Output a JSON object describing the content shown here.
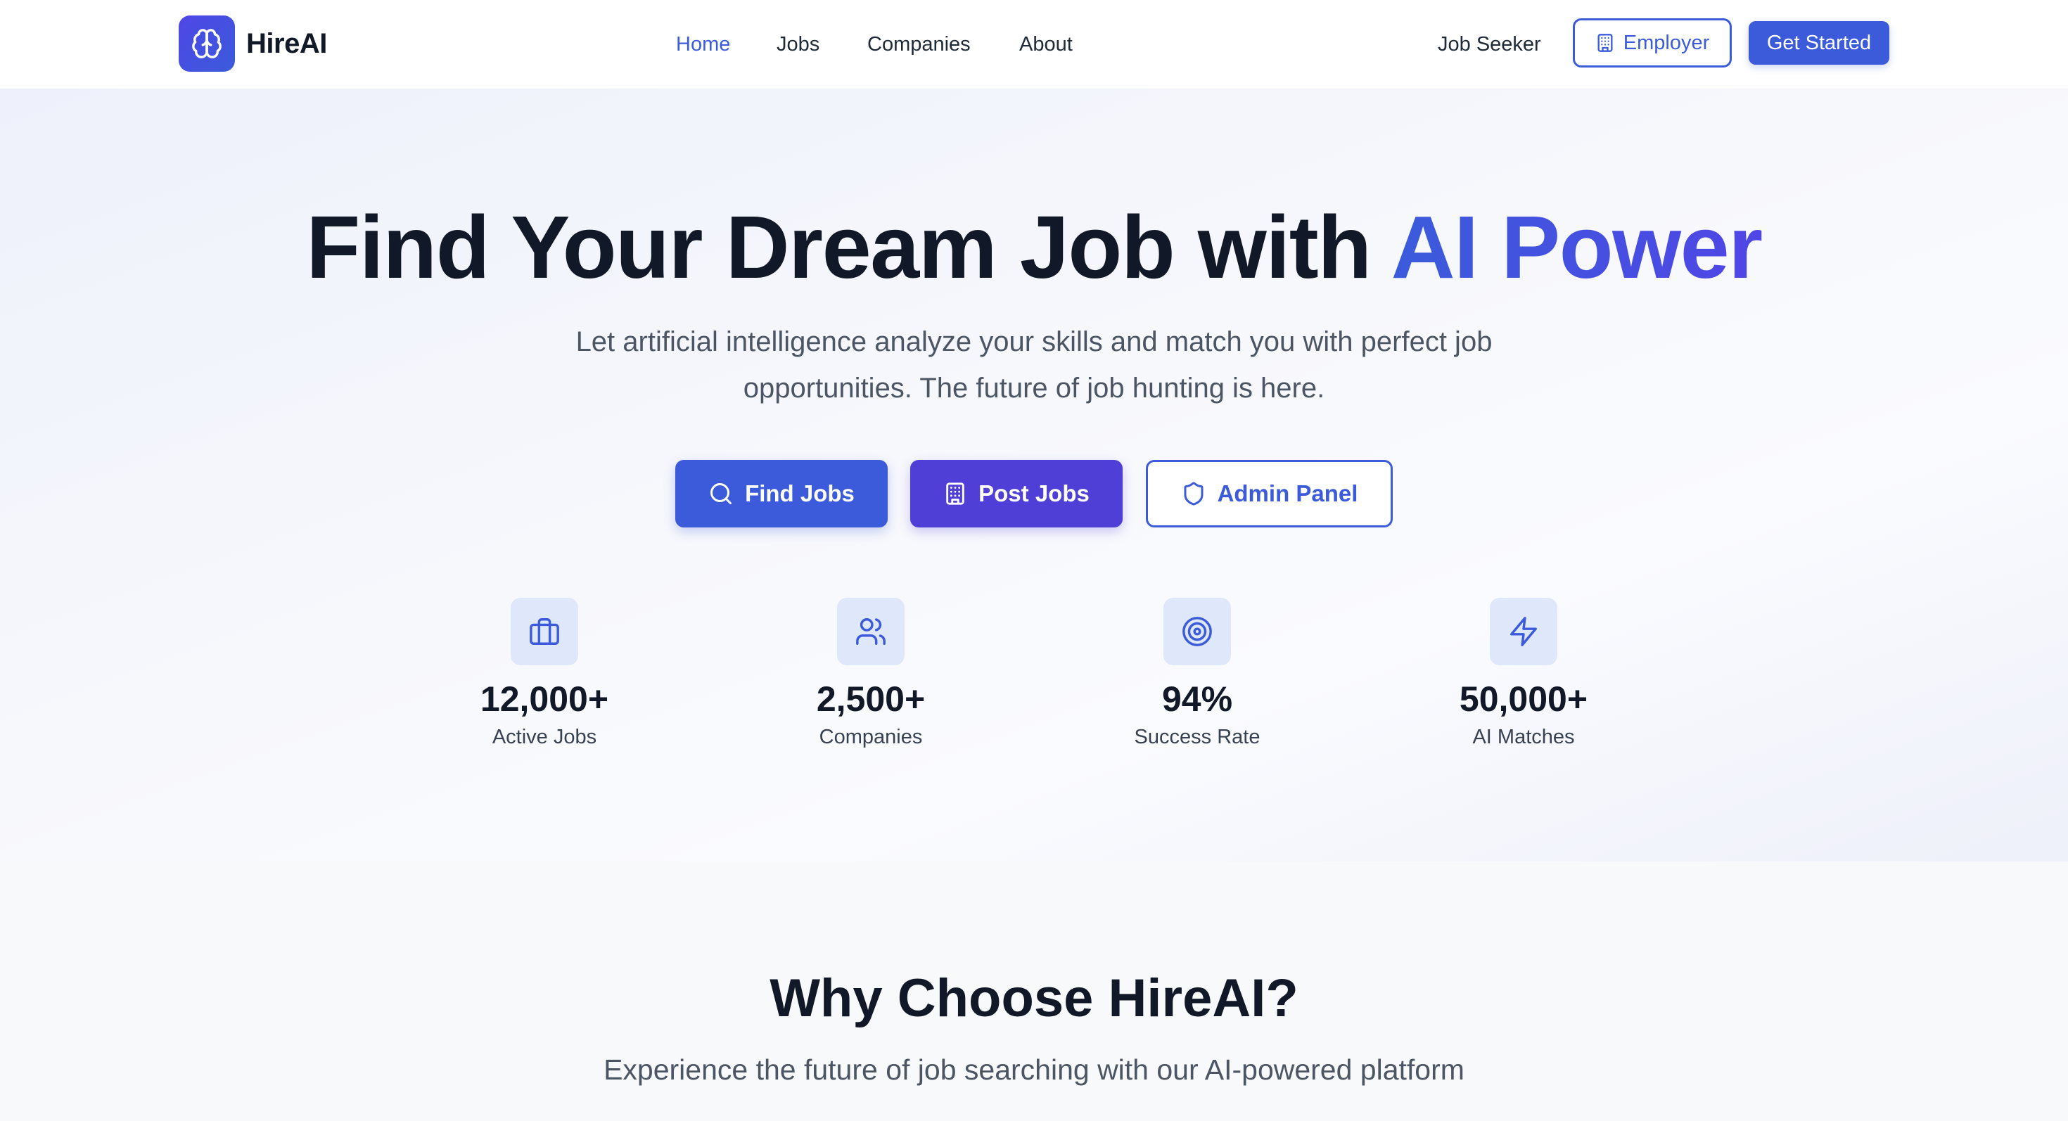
{
  "brand": {
    "name": "HireAI",
    "logo_icon": "brain-icon"
  },
  "nav": {
    "links": [
      "Home",
      "Jobs",
      "Companies",
      "About"
    ],
    "active": "Home",
    "job_seeker_label": "Job Seeker",
    "employer_label": "Employer",
    "get_started_label": "Get Started"
  },
  "hero": {
    "title_main": "Find Your Dream Job with ",
    "title_accent": "AI Power",
    "subtitle": "Let artificial intelligence analyze your skills and match you with perfect job opportunities. The future of job hunting is here.",
    "buttons": {
      "find_jobs": "Find Jobs",
      "post_jobs": "Post Jobs",
      "admin_panel": "Admin Panel"
    },
    "stats": [
      {
        "value": "12,000+",
        "label": "Active Jobs",
        "icon": "briefcase-icon"
      },
      {
        "value": "2,500+",
        "label": "Companies",
        "icon": "users-icon"
      },
      {
        "value": "94%",
        "label": "Success Rate",
        "icon": "target-icon"
      },
      {
        "value": "50,000+",
        "label": "AI Matches",
        "icon": "lightning-icon"
      }
    ]
  },
  "why": {
    "title": "Why Choose HireAI?",
    "subtitle": "Experience the future of job searching with our AI-powered platform"
  },
  "colors": {
    "primary": "#3b5bdb",
    "secondary": "#4f3fd6",
    "text": "#111827",
    "muted": "#4b5563",
    "icon_bg": "#dfe7fb"
  }
}
